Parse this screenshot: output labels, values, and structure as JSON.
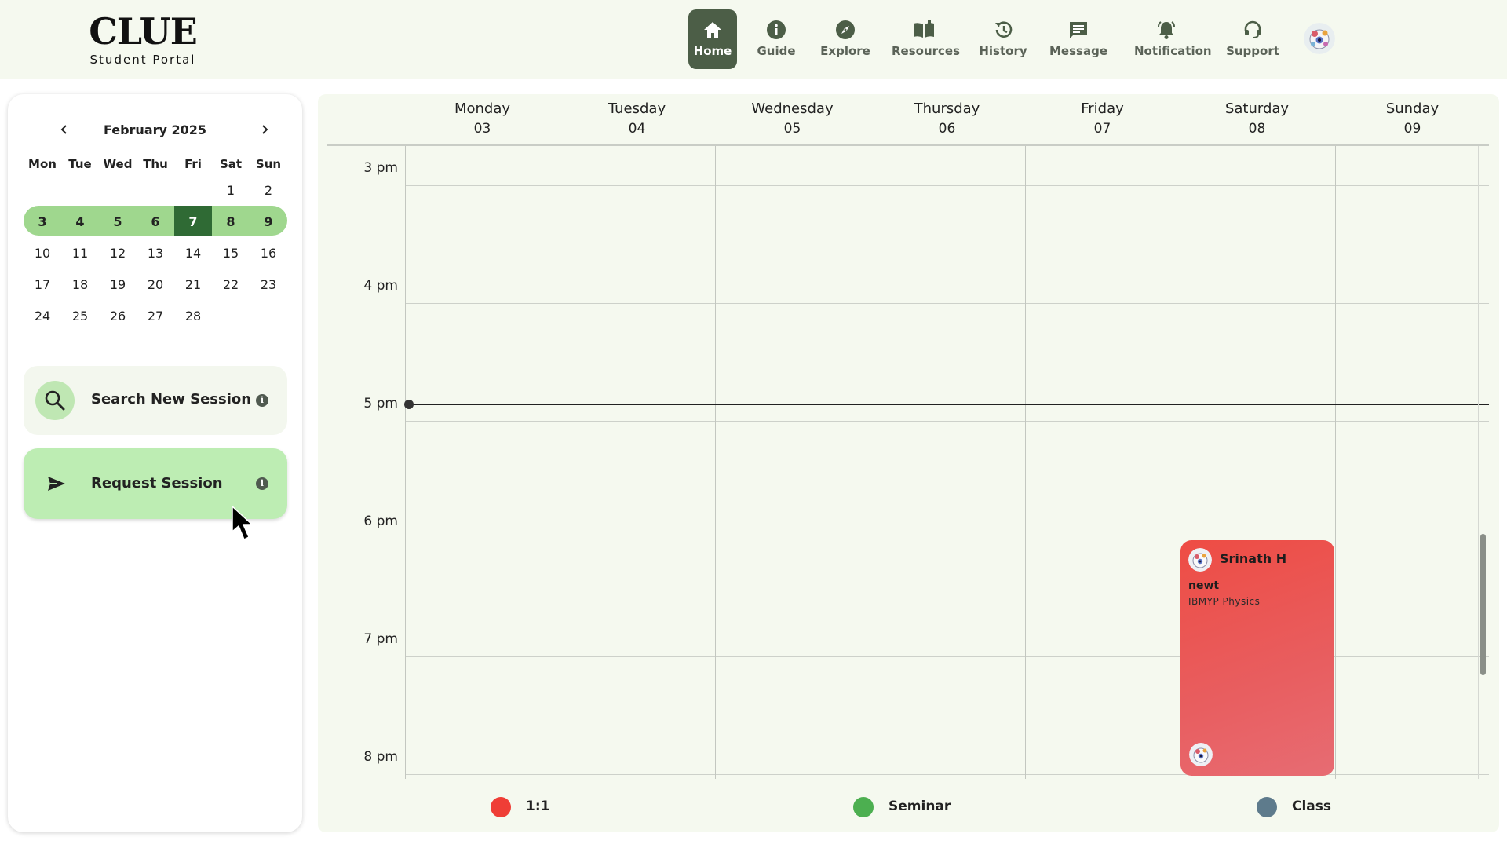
{
  "brand": {
    "title": "CLUE",
    "subtitle": "Student Portal"
  },
  "nav": {
    "items": [
      {
        "label": "Home",
        "icon": "home-icon",
        "active": true
      },
      {
        "label": "Guide",
        "icon": "info-icon"
      },
      {
        "label": "Explore",
        "icon": "compass-icon"
      },
      {
        "label": "Resources",
        "icon": "book-icon"
      },
      {
        "label": "History",
        "icon": "history-icon"
      },
      {
        "label": "Message",
        "icon": "message-icon"
      },
      {
        "label": "Notification",
        "icon": "bell-icon"
      },
      {
        "label": "Support",
        "icon": "headset-icon"
      }
    ],
    "avatar_icon": "user-avatar"
  },
  "mini_calendar": {
    "month_label": "February 2025",
    "weekday_labels": [
      "Mon",
      "Tue",
      "Wed",
      "Thu",
      "Fri",
      "Sat",
      "Sun"
    ],
    "weeks": [
      [
        "",
        "",
        "",
        "",
        "",
        "1",
        "2"
      ],
      [
        "3",
        "4",
        "5",
        "6",
        "7",
        "8",
        "9"
      ],
      [
        "10",
        "11",
        "12",
        "13",
        "14",
        "15",
        "16"
      ],
      [
        "17",
        "18",
        "19",
        "20",
        "21",
        "22",
        "23"
      ],
      [
        "24",
        "25",
        "26",
        "27",
        "28",
        "",
        ""
      ]
    ],
    "selected_week_index": 1,
    "today_label": "7"
  },
  "actions": {
    "search_label": "Search New Session",
    "request_label": "Request Session"
  },
  "week_view": {
    "days": [
      {
        "name": "Monday",
        "date": "03"
      },
      {
        "name": "Tuesday",
        "date": "04"
      },
      {
        "name": "Wednesday",
        "date": "05"
      },
      {
        "name": "Thursday",
        "date": "06"
      },
      {
        "name": "Friday",
        "date": "07"
      },
      {
        "name": "Saturday",
        "date": "08"
      },
      {
        "name": "Sunday",
        "date": "09"
      }
    ],
    "time_labels": [
      "3 pm",
      "4 pm",
      "5 pm",
      "6 pm",
      "7 pm",
      "8 pm"
    ],
    "current_time_label": "5 pm",
    "event": {
      "day": "Saturday",
      "host_name": "Srinath H",
      "title": "newt",
      "subject": "IBMYP Physics",
      "color": "#ef4a43"
    }
  },
  "legend": [
    {
      "label": "1:1",
      "color": "#ef3e36"
    },
    {
      "label": "Seminar",
      "color": "#4caf50"
    },
    {
      "label": "Class",
      "color": "#5e7b8c"
    }
  ],
  "colors": {
    "header_bg": "#f5f9ef",
    "nav_active": "#4c5e47",
    "week_highlight": "#9fd78e",
    "today_highlight": "#2f6a34",
    "request_card": "#bdedb3"
  }
}
